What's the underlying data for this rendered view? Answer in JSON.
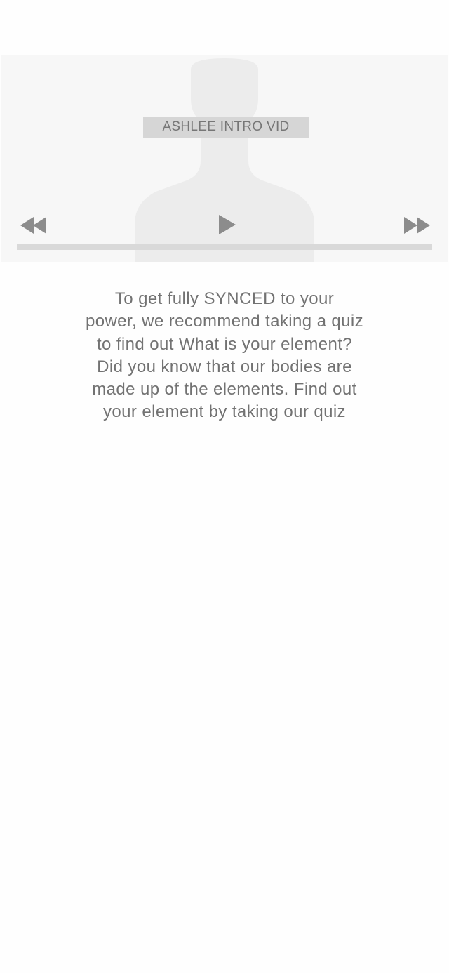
{
  "video": {
    "title": "ASHLEE INTRO VID",
    "progress": 0,
    "controls": {
      "rewind_icon": "rewind-icon",
      "play_icon": "play-icon",
      "forward_icon": "fast-forward-icon"
    },
    "colors": {
      "background": "#f7f7f7",
      "silhouette": "#ececec",
      "control": "#8c8c8c",
      "track": "#d9d9d9"
    }
  },
  "intro": {
    "text": "To get fully SYNCED to your\npower, we recommend taking a quiz\nto find out What is your element?\nDid you know that our bodies are\nmade up of the elements.  Find out\nyour element by taking our quiz"
  }
}
